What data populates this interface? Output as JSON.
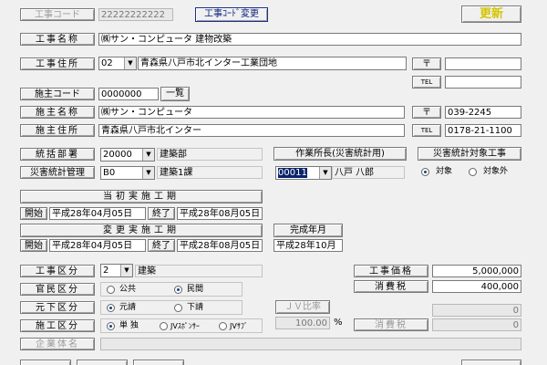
{
  "header": {
    "koji_code_label": "工事コード",
    "koji_code_value": "22222222222",
    "code_change_button": "工事ｺｰﾄﾞ変更",
    "update_button": "更新"
  },
  "koji": {
    "name_label": "工事名称",
    "name_value": "㈱サン・コンピュータ 建物改築",
    "address_label": "工事住所",
    "pref_code": "02",
    "address_value": "青森県八戸市北インター工業団地",
    "postal_label": "〒",
    "postal_value": "",
    "tel_label": "TEL",
    "tel_value": ""
  },
  "seshu": {
    "code_label": "施主コード",
    "code_value": "0000000",
    "list_button": "一覧",
    "name_label": "施主名称",
    "name_value": "㈱サン・コンピュータ",
    "postal_label": "〒",
    "postal_value": "039-2245",
    "address_label": "施主住所",
    "address_value": "青森県八戸市北インター",
    "tel_label": "TEL",
    "tel_value": "0178-21-1100"
  },
  "dept": {
    "tokatsu_label": "統括部署",
    "tokatsu_code": "20000",
    "tokatsu_name": "建築部",
    "saigai_label": "災害統計管理",
    "saigai_code": "B0",
    "saigai_name": "建築1課",
    "sagyo_label": "作業所長(災害統計用)",
    "sagyo_code": "00011",
    "sagyo_name": "八戸 八郎",
    "target_label": "災害統計対象工事",
    "target_on": "対象",
    "target_off": "対象外"
  },
  "period_initial": {
    "title": "当初実施工期",
    "start_label": "開始",
    "start_value": "平成28年04月05日",
    "end_label": "終了",
    "end_value": "平成28年08月05日"
  },
  "period_changed": {
    "title": "変更実施工期",
    "start_label": "開始",
    "start_value": "平成28年04月05日",
    "end_label": "終了",
    "end_value": "平成28年08月05日",
    "completion_label": "完成年月",
    "completion_value": "平成28年10月"
  },
  "kubun": {
    "koji_label": "工事区分",
    "koji_code": "2",
    "koji_name": "建築",
    "kanmin_label": "官民区分",
    "kanmin_opt1": "公共",
    "kanmin_opt2": "民間",
    "motoshita_label": "元下区分",
    "motoshita_opt1": "元請",
    "motoshita_opt2": "下請",
    "seko_label": "施工区分",
    "seko_opt1": "単 独",
    "seko_opt2": "JVｽﾎﾟﾝｻｰ",
    "seko_opt3": "JVｻﾌﾞ",
    "kigyo_label": "企業体名",
    "kigyo_value": ""
  },
  "jv": {
    "ratio_label": "ＪＶ比率",
    "ratio_value": "100.00",
    "ratio_unit": "%"
  },
  "price": {
    "koji_price_label": "工事価格",
    "koji_price_value": "5,000,000",
    "tax_label": "消費税",
    "tax_value": "400,000",
    "jv_price_value": "0",
    "jv_tax_label": "消費税",
    "jv_tax_value": "0"
  }
}
